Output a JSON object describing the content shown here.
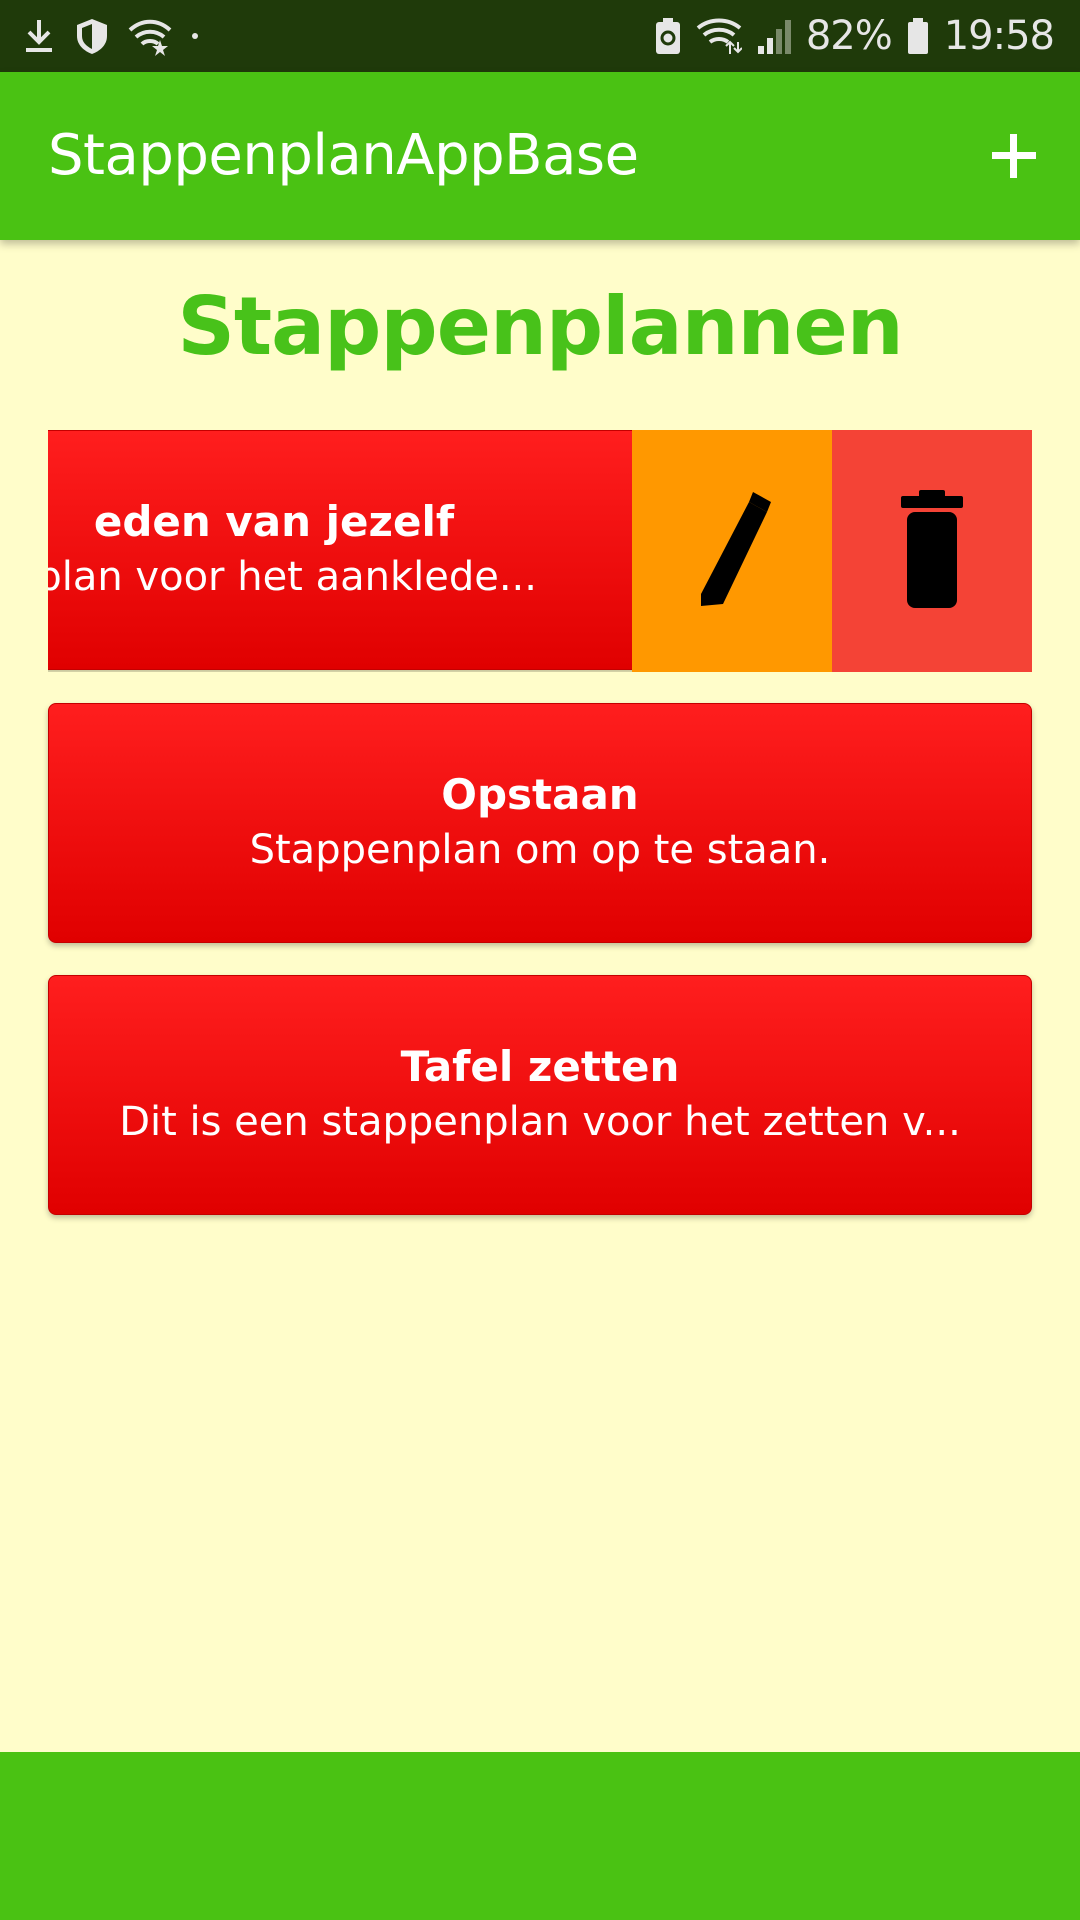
{
  "status_bar": {
    "battery_percent": "82%",
    "time": "19:58"
  },
  "app_bar": {
    "title": "StappenplanAppBase",
    "add_icon": "plus-icon"
  },
  "heading": "Stappenplannen",
  "plans": [
    {
      "title": "eden van jezelf",
      "description": "nplan voor het aanklede...",
      "swiped": true,
      "actions": [
        {
          "icon": "pencil-icon",
          "color": "#FF9800"
        },
        {
          "icon": "trash-icon",
          "color": "#F44336"
        }
      ]
    },
    {
      "title": "Opstaan",
      "description": "Stappenplan om op te staan."
    },
    {
      "title": "Tafel zetten",
      "description": "Dit is een stappenplan voor het zetten v..."
    }
  ],
  "colors": {
    "primary": "#4AC213",
    "heading": "#48C21A",
    "background": "#FFFDCA",
    "card": "#F01010",
    "edit": "#FF9800",
    "delete": "#F44336"
  }
}
